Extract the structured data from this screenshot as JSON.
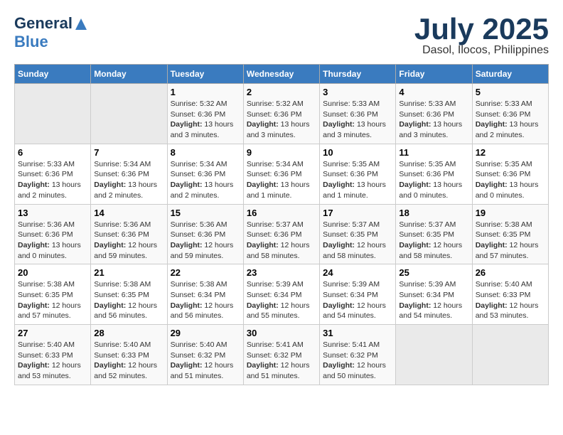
{
  "header": {
    "logo_general": "General",
    "logo_blue": "Blue",
    "title": "July 2025",
    "subtitle": "Dasol, Ilocos, Philippines"
  },
  "weekdays": [
    "Sunday",
    "Monday",
    "Tuesday",
    "Wednesday",
    "Thursday",
    "Friday",
    "Saturday"
  ],
  "weeks": [
    [
      {
        "day": "",
        "info": ""
      },
      {
        "day": "",
        "info": ""
      },
      {
        "day": "1",
        "info": "Sunrise: 5:32 AM\nSunset: 6:36 PM\nDaylight: 13 hours and 3 minutes."
      },
      {
        "day": "2",
        "info": "Sunrise: 5:32 AM\nSunset: 6:36 PM\nDaylight: 13 hours and 3 minutes."
      },
      {
        "day": "3",
        "info": "Sunrise: 5:33 AM\nSunset: 6:36 PM\nDaylight: 13 hours and 3 minutes."
      },
      {
        "day": "4",
        "info": "Sunrise: 5:33 AM\nSunset: 6:36 PM\nDaylight: 13 hours and 3 minutes."
      },
      {
        "day": "5",
        "info": "Sunrise: 5:33 AM\nSunset: 6:36 PM\nDaylight: 13 hours and 2 minutes."
      }
    ],
    [
      {
        "day": "6",
        "info": "Sunrise: 5:33 AM\nSunset: 6:36 PM\nDaylight: 13 hours and 2 minutes."
      },
      {
        "day": "7",
        "info": "Sunrise: 5:34 AM\nSunset: 6:36 PM\nDaylight: 13 hours and 2 minutes."
      },
      {
        "day": "8",
        "info": "Sunrise: 5:34 AM\nSunset: 6:36 PM\nDaylight: 13 hours and 2 minutes."
      },
      {
        "day": "9",
        "info": "Sunrise: 5:34 AM\nSunset: 6:36 PM\nDaylight: 13 hours and 1 minute."
      },
      {
        "day": "10",
        "info": "Sunrise: 5:35 AM\nSunset: 6:36 PM\nDaylight: 13 hours and 1 minute."
      },
      {
        "day": "11",
        "info": "Sunrise: 5:35 AM\nSunset: 6:36 PM\nDaylight: 13 hours and 0 minutes."
      },
      {
        "day": "12",
        "info": "Sunrise: 5:35 AM\nSunset: 6:36 PM\nDaylight: 13 hours and 0 minutes."
      }
    ],
    [
      {
        "day": "13",
        "info": "Sunrise: 5:36 AM\nSunset: 6:36 PM\nDaylight: 13 hours and 0 minutes."
      },
      {
        "day": "14",
        "info": "Sunrise: 5:36 AM\nSunset: 6:36 PM\nDaylight: 12 hours and 59 minutes."
      },
      {
        "day": "15",
        "info": "Sunrise: 5:36 AM\nSunset: 6:36 PM\nDaylight: 12 hours and 59 minutes."
      },
      {
        "day": "16",
        "info": "Sunrise: 5:37 AM\nSunset: 6:36 PM\nDaylight: 12 hours and 58 minutes."
      },
      {
        "day": "17",
        "info": "Sunrise: 5:37 AM\nSunset: 6:35 PM\nDaylight: 12 hours and 58 minutes."
      },
      {
        "day": "18",
        "info": "Sunrise: 5:37 AM\nSunset: 6:35 PM\nDaylight: 12 hours and 58 minutes."
      },
      {
        "day": "19",
        "info": "Sunrise: 5:38 AM\nSunset: 6:35 PM\nDaylight: 12 hours and 57 minutes."
      }
    ],
    [
      {
        "day": "20",
        "info": "Sunrise: 5:38 AM\nSunset: 6:35 PM\nDaylight: 12 hours and 57 minutes."
      },
      {
        "day": "21",
        "info": "Sunrise: 5:38 AM\nSunset: 6:35 PM\nDaylight: 12 hours and 56 minutes."
      },
      {
        "day": "22",
        "info": "Sunrise: 5:38 AM\nSunset: 6:34 PM\nDaylight: 12 hours and 56 minutes."
      },
      {
        "day": "23",
        "info": "Sunrise: 5:39 AM\nSunset: 6:34 PM\nDaylight: 12 hours and 55 minutes."
      },
      {
        "day": "24",
        "info": "Sunrise: 5:39 AM\nSunset: 6:34 PM\nDaylight: 12 hours and 54 minutes."
      },
      {
        "day": "25",
        "info": "Sunrise: 5:39 AM\nSunset: 6:34 PM\nDaylight: 12 hours and 54 minutes."
      },
      {
        "day": "26",
        "info": "Sunrise: 5:40 AM\nSunset: 6:33 PM\nDaylight: 12 hours and 53 minutes."
      }
    ],
    [
      {
        "day": "27",
        "info": "Sunrise: 5:40 AM\nSunset: 6:33 PM\nDaylight: 12 hours and 53 minutes."
      },
      {
        "day": "28",
        "info": "Sunrise: 5:40 AM\nSunset: 6:33 PM\nDaylight: 12 hours and 52 minutes."
      },
      {
        "day": "29",
        "info": "Sunrise: 5:40 AM\nSunset: 6:32 PM\nDaylight: 12 hours and 51 minutes."
      },
      {
        "day": "30",
        "info": "Sunrise: 5:41 AM\nSunset: 6:32 PM\nDaylight: 12 hours and 51 minutes."
      },
      {
        "day": "31",
        "info": "Sunrise: 5:41 AM\nSunset: 6:32 PM\nDaylight: 12 hours and 50 minutes."
      },
      {
        "day": "",
        "info": ""
      },
      {
        "day": "",
        "info": ""
      }
    ]
  ]
}
